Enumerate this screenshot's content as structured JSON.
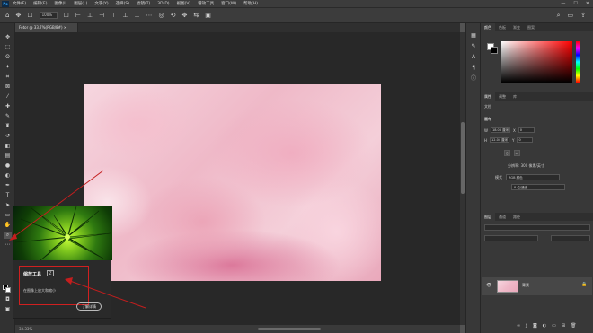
{
  "menubar": {
    "logo": "Ps",
    "items": [
      "文件(F)",
      "编辑(E)",
      "图像(I)",
      "图层(L)",
      "文字(Y)",
      "选择(S)",
      "滤镜(T)",
      "3D(D)",
      "视图(V)",
      "增效工具",
      "窗口(W)",
      "帮助(H)"
    ],
    "controls": [
      "—",
      "☐",
      "✕"
    ]
  },
  "options": {
    "zoom_field": "100%"
  },
  "document": {
    "tab_title": "Fotor @ 33.7%(RGB/8#) ×",
    "status_zoom": "33.33%"
  },
  "tooltip": {
    "title": "缩放工具",
    "key": "Z",
    "description": "在图像上放大和缩小",
    "button": "了解详情"
  },
  "panels": {
    "color_tabs": [
      "颜色",
      "色板",
      "渐变",
      "图案"
    ],
    "properties_tabs": [
      "属性",
      "调整",
      "库"
    ],
    "properties_subtitle": "文档",
    "canvas_section": "画布",
    "width_label": "W",
    "width_value": "18.06 厘米",
    "height_label": "H",
    "height_value": "12.04 厘米",
    "x_value": "0",
    "y_value": "0",
    "resolution": "分辨率: 300 像素/英寸",
    "mode_label": "模式",
    "mode_value": "RGB 颜色",
    "bit_depth": "8 位/通道",
    "layers_tabs": [
      "图层",
      "通道",
      "路径"
    ],
    "layer_name": "背景"
  },
  "colors": {
    "annotation_red": "#c41e1e",
    "accent_blue": "#31a8ff"
  }
}
